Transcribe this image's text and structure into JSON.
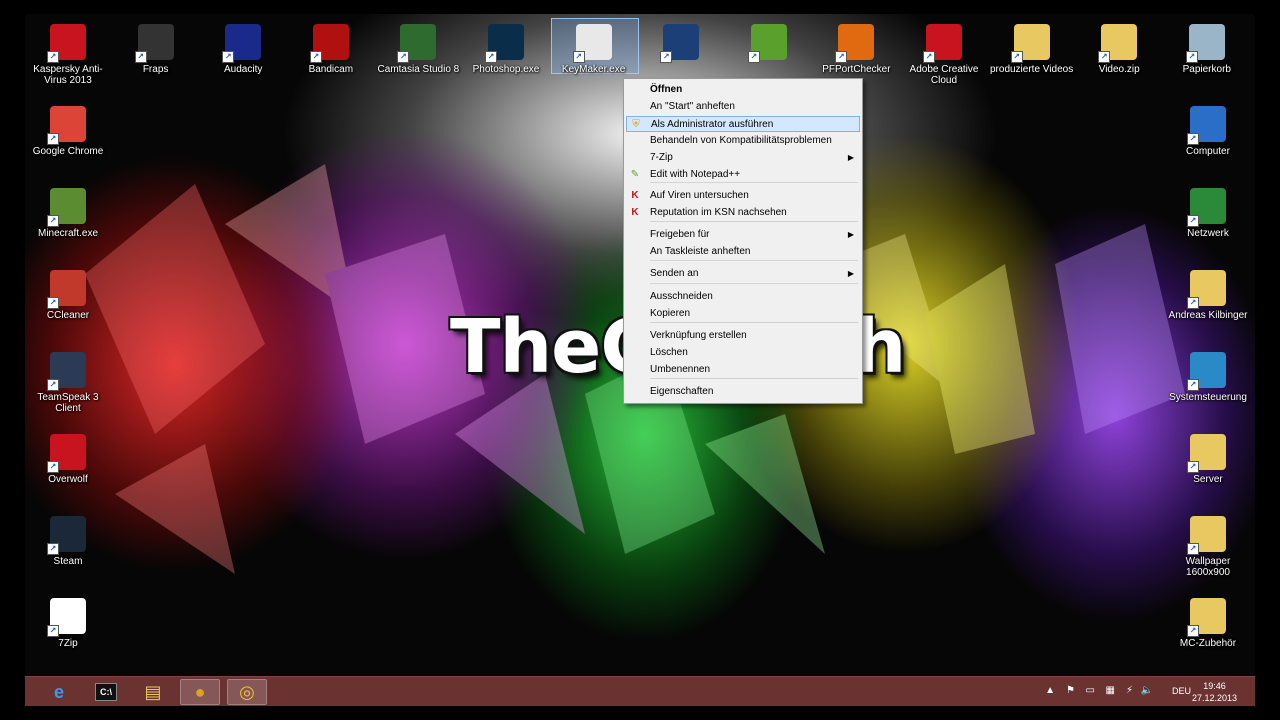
{
  "desktop": {
    "brand_text": "TheC",
    "brand_text_tail": "h",
    "icons_top": [
      {
        "label": "Kaspersky Anti-Virus 2013",
        "icon": "kaspersky-icon",
        "color": "#c8141e"
      },
      {
        "label": "Fraps",
        "icon": "fraps-icon",
        "color": "#333333"
      },
      {
        "label": "Audacity",
        "icon": "audacity-icon",
        "color": "#1a2a8a"
      },
      {
        "label": "Bandicam",
        "icon": "bandicam-icon",
        "color": "#b01010"
      },
      {
        "label": "Camtasia Studio 8",
        "icon": "camtasia-icon",
        "color": "#2e6b2e"
      },
      {
        "label": "Photoshop.exe",
        "icon": "photoshop-icon",
        "color": "#0a2d4a"
      },
      {
        "label": "KeyMaker.exe",
        "icon": "keymaker-icon",
        "color": "#e8e8e8"
      },
      {
        "label": "",
        "icon": "gear-app-icon",
        "color": "#1c3f78"
      },
      {
        "label": "",
        "icon": "green-app-icon",
        "color": "#5aa02c"
      },
      {
        "label": "PFPortChecker",
        "icon": "pfportchecker-icon",
        "color": "#e06a10"
      },
      {
        "label": "Adobe Creative Cloud",
        "icon": "creative-cloud-icon",
        "color": "#c8141e"
      },
      {
        "label": "produzierte Videos",
        "icon": "folder-icon",
        "color": "#e8c860"
      },
      {
        "label": "Video.zip",
        "icon": "zip-folder-icon",
        "color": "#e8c860"
      },
      {
        "label": "Papierkorb",
        "icon": "recycle-bin-icon",
        "color": "#9ab4c8"
      }
    ],
    "icons_left": [
      {
        "label": "Google Chrome",
        "icon": "chrome-icon",
        "color": "#db4437"
      },
      {
        "label": "Minecraft.exe",
        "icon": "minecraft-icon",
        "color": "#5b8c32"
      },
      {
        "label": "CCleaner",
        "icon": "ccleaner-icon",
        "color": "#c0392b"
      },
      {
        "label": "TeamSpeak 3 Client",
        "icon": "teamspeak-icon",
        "color": "#2b3a55"
      },
      {
        "label": "Overwolf",
        "icon": "overwolf-icon",
        "color": "#c8141e"
      },
      {
        "label": "Steam",
        "icon": "steam-icon",
        "color": "#1b2838"
      },
      {
        "label": "7Zip",
        "icon": "7zip-icon",
        "color": "#ffffff"
      }
    ],
    "icons_right": [
      {
        "label": "Computer",
        "icon": "computer-icon",
        "color": "#2a6ec8"
      },
      {
        "label": "Netzwerk",
        "icon": "network-icon",
        "color": "#2a8a3a"
      },
      {
        "label": "Andreas Kilbinger",
        "icon": "user-folder-icon",
        "color": "#e8c860"
      },
      {
        "label": "Systemsteuerung",
        "icon": "control-panel-icon",
        "color": "#2a8ac8"
      },
      {
        "label": "Server",
        "icon": "folder-icon",
        "color": "#e8c860"
      },
      {
        "label": "Wallpaper 1600x900",
        "icon": "folder-icon",
        "color": "#e8c860"
      },
      {
        "label": "MC-Zubehör",
        "icon": "folder-icon",
        "color": "#e8c860"
      }
    ]
  },
  "context_menu": {
    "items": [
      {
        "label": "Öffnen",
        "bold": true
      },
      {
        "label": "An \"Start\" anheften"
      },
      {
        "label": "Als Administrator ausführen",
        "icon": "uac-shield-icon",
        "highlight": true
      },
      {
        "label": "Behandeln von Kompatibilitätsproblemen"
      },
      {
        "label": "7-Zip",
        "submenu": true
      },
      {
        "label": "Edit with Notepad++",
        "icon": "notepad-plus-icon"
      },
      {
        "label": "Auf Viren untersuchen",
        "icon": "kaspersky-icon"
      },
      {
        "label": "Reputation im KSN nachsehen",
        "icon": "kaspersky-icon"
      },
      {
        "label": "Freigeben für",
        "submenu": true
      },
      {
        "label": "An Taskleiste anheften"
      },
      {
        "label": "Senden an",
        "submenu": true
      },
      {
        "label": "Ausschneiden"
      },
      {
        "label": "Kopieren"
      },
      {
        "label": "Verknüpfung erstellen"
      },
      {
        "label": "Löschen"
      },
      {
        "label": "Umbenennen"
      },
      {
        "label": "Eigenschaften"
      }
    ]
  },
  "taskbar": {
    "apps": [
      {
        "icon": "internet-explorer-icon"
      },
      {
        "icon": "command-prompt-icon"
      },
      {
        "icon": "file-explorer-icon"
      },
      {
        "icon": "chrome-icon",
        "active": true
      },
      {
        "icon": "teamspeak-icon",
        "active": true
      }
    ],
    "language": "DEU",
    "time": "19:46",
    "date": "27.12.2013"
  }
}
